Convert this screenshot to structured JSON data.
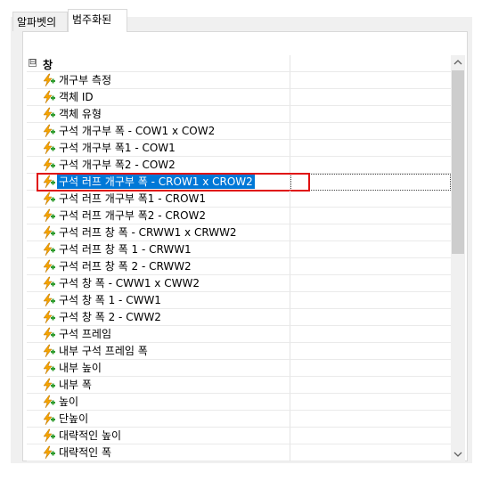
{
  "tabs": [
    {
      "label": "알파벳의",
      "active": false
    },
    {
      "label": "범주화된",
      "active": true
    }
  ],
  "category": {
    "label": "창",
    "expander": "⊟"
  },
  "properties": [
    {
      "label": "개구부 측정",
      "checked": false
    },
    {
      "label": "객체 ID",
      "checked": false
    },
    {
      "label": "객체 유형",
      "checked": false
    },
    {
      "label": "구석 개구부 폭 - COW1 x COW2",
      "checked": false
    },
    {
      "label": "구석 개구부 폭1 - COW1",
      "checked": false
    },
    {
      "label": "구석 개구부 폭2 - COW2",
      "checked": false
    },
    {
      "label": "구석 러프 개구부 폭 - CROW1 x CROW2",
      "checked": true,
      "selected": true
    },
    {
      "label": "구석 러프 개구부 폭1 - CROW1",
      "checked": false
    },
    {
      "label": "구석 러프 개구부 폭2 - CROW2",
      "checked": false
    },
    {
      "label": "구석 러프 창 폭 - CRWW1 x CRWW2",
      "checked": false
    },
    {
      "label": "구석 러프 창 폭 1 - CRWW1",
      "checked": false
    },
    {
      "label": "구석 러프 창 폭 2 - CRWW2",
      "checked": false
    },
    {
      "label": "구석 창 폭 - CWW1 x CWW2",
      "checked": false
    },
    {
      "label": "구석 창 폭 1 - CWW1",
      "checked": false
    },
    {
      "label": "구석 창 폭 2 - CWW2",
      "checked": false
    },
    {
      "label": "구석 프레임",
      "checked": false
    },
    {
      "label": "내부 구석 프레임 폭",
      "checked": false
    },
    {
      "label": "내부 높이",
      "checked": false
    },
    {
      "label": "내부 폭",
      "checked": false
    },
    {
      "label": "높이",
      "checked": false
    },
    {
      "label": "단높이",
      "checked": false
    },
    {
      "label": "대략적인 높이",
      "checked": false
    },
    {
      "label": "대략적인 폭",
      "checked": false
    }
  ],
  "icons": {
    "property": "lightning-plus-icon",
    "scroll_up": "chevron-up-icon",
    "scroll_down": "chevron-down-icon"
  },
  "colors": {
    "selection": "#0078d7",
    "highlight_border": "#e01010",
    "icon_bolt": "#f5a300",
    "icon_plus": "#2e9b2e"
  }
}
